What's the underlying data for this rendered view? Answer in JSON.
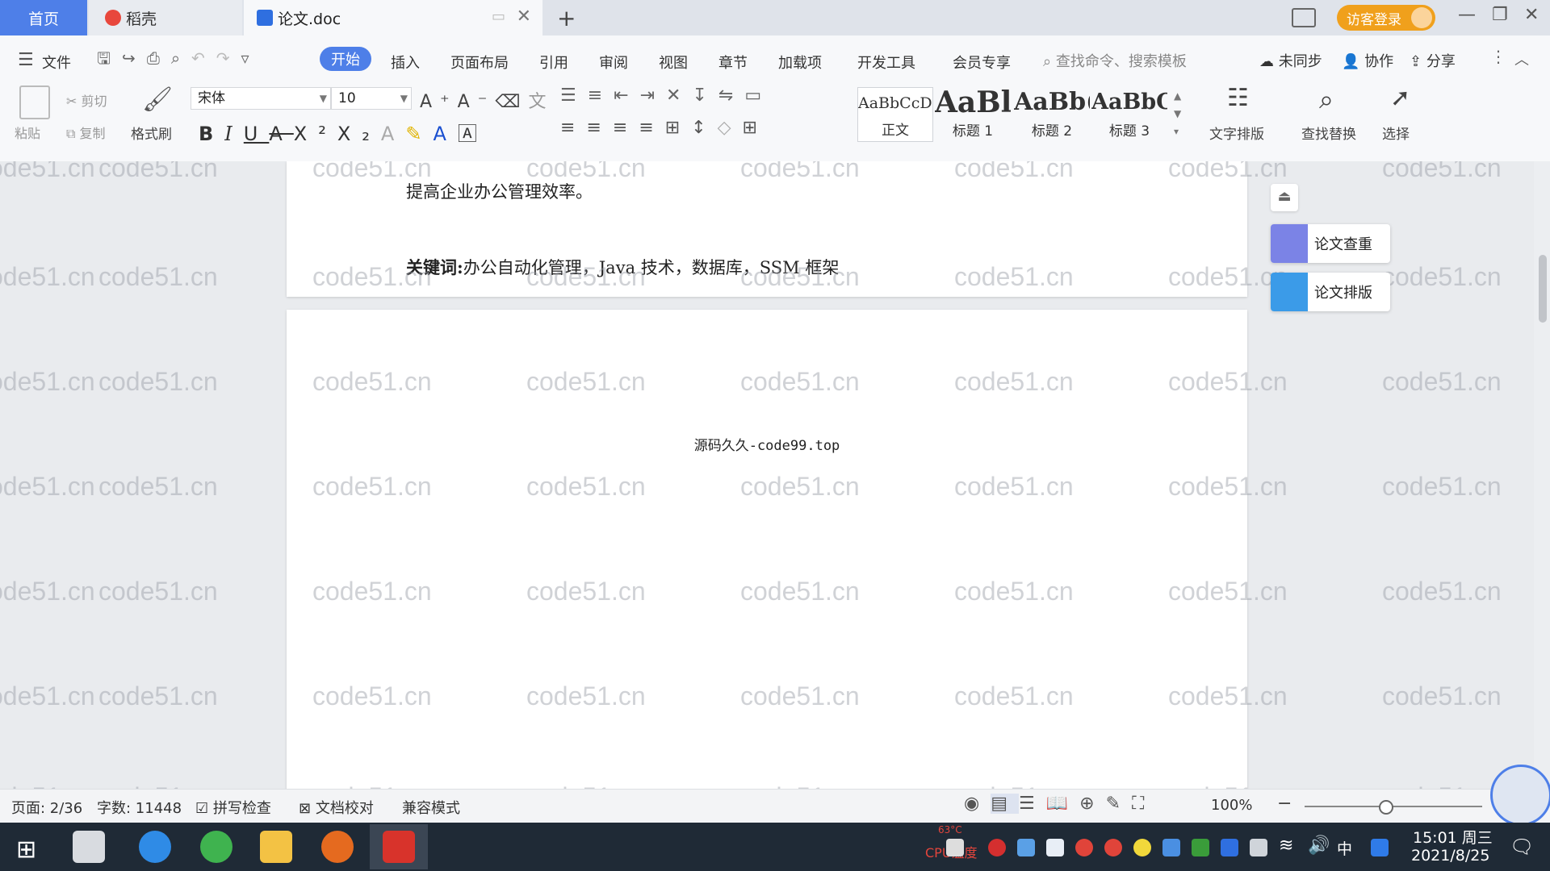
{
  "tabs": {
    "home": "首页",
    "daoke": "稻壳",
    "doc": "论文.doc"
  },
  "header": {
    "login": "访客登录"
  },
  "menu": {
    "file": "文件",
    "items": [
      "开始",
      "插入",
      "页面布局",
      "引用",
      "审阅",
      "视图",
      "章节",
      "加载项",
      "开发工具",
      "会员专享"
    ],
    "search_placeholder": "查找命令、搜索模板",
    "sync": "未同步",
    "collab": "协作",
    "share": "分享"
  },
  "ribbon": {
    "paste": "粘贴",
    "cut": "剪切",
    "copy": "复制",
    "format_painter": "格式刷",
    "font_name": "宋体",
    "font_size": "10",
    "styles": [
      {
        "sample": "AaBbCcDd",
        "label": "正文"
      },
      {
        "sample": "AaBl",
        "label": "标题 1"
      },
      {
        "sample": "AaBb(",
        "label": "标题 2"
      },
      {
        "sample": "AaBbC",
        "label": "标题 3"
      }
    ],
    "text_layout": "文字排版",
    "find_replace": "查找替换",
    "select": "选择"
  },
  "document": {
    "page1_line": "提高企业办公管理效率。",
    "keywords_label": "关键词:",
    "keywords_text": "办公自动化管理，Java 技术，数据库，SSM 框架",
    "page2_header": "源码久久-code99.top"
  },
  "watermark": "code51.cn",
  "side_panel": {
    "check": "论文查重",
    "layout": "论文排版"
  },
  "status": {
    "page": "页面: 2/36",
    "words": "字数: 11448",
    "spell": "拼写检查",
    "proof": "文档校对",
    "compat": "兼容模式",
    "zoom": "100%"
  },
  "taskbar": {
    "cpu_label": "CPU温度",
    "cpu_value": "63°C",
    "ime": "中",
    "time": "15:01 周三",
    "date": "2021/8/25"
  },
  "colors": {
    "accent": "#4e7fe8",
    "login": "#f0a01c",
    "taskbar": "#1f2a36"
  }
}
